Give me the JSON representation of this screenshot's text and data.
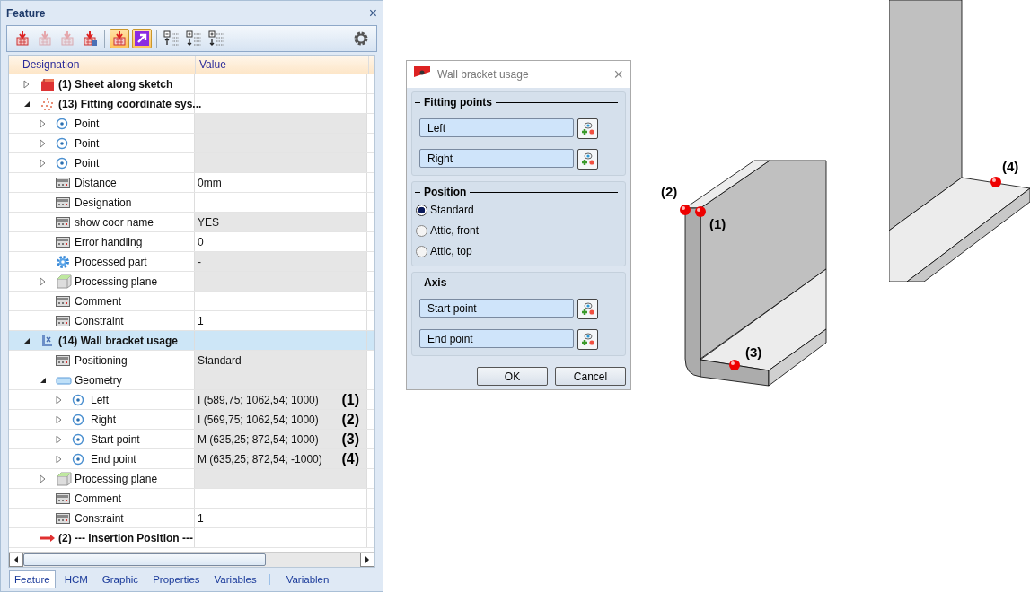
{
  "panel": {
    "title": "Feature",
    "close": "×"
  },
  "toolbar": [
    {
      "kind": "insert",
      "on": false,
      "disabled": false
    },
    {
      "kind": "insert",
      "on": false,
      "disabled": true
    },
    {
      "kind": "insert",
      "on": false,
      "disabled": true
    },
    {
      "kind": "insert-edit",
      "on": false,
      "disabled": false
    },
    {
      "kind": "separator"
    },
    {
      "kind": "insert",
      "on": true,
      "disabled": false
    },
    {
      "kind": "arrow",
      "on": true,
      "disabled": false
    },
    {
      "kind": "separator"
    },
    {
      "kind": "collapse",
      "on": false,
      "disabled": false
    },
    {
      "kind": "expand-level",
      "on": false,
      "disabled": false
    },
    {
      "kind": "expand",
      "on": false,
      "disabled": false
    },
    {
      "kind": "settings",
      "on": false,
      "disabled": false
    }
  ],
  "table": {
    "columns": [
      "Designation",
      "Value"
    ],
    "rows": [
      {
        "label": "(1) Sheet along sketch",
        "kind": "sheet",
        "expanded": false,
        "selected": false,
        "read_only": false
      },
      {
        "label": "(13) Fitting coordinate sys...",
        "kind": "coordinates",
        "expanded": true,
        "selected": false,
        "read_only": false,
        "children": [
          {
            "label": "Point",
            "kind": "point",
            "expanded": false,
            "selected": false,
            "read_only": true
          },
          {
            "label": "Point",
            "kind": "point",
            "expanded": false,
            "selected": false,
            "read_only": true
          },
          {
            "label": "Point",
            "kind": "point",
            "expanded": false,
            "selected": false,
            "read_only": true
          },
          {
            "label": "Distance",
            "value": "0mm",
            "kind": "parameter",
            "selected": false,
            "read_only": false
          },
          {
            "label": "Designation",
            "kind": "parameter",
            "selected": false,
            "read_only": false
          },
          {
            "label": "show coor name",
            "value": "YES",
            "kind": "parameter",
            "selected": false,
            "read_only": true
          },
          {
            "label": "Error handling",
            "value": "0",
            "kind": "parameter",
            "selected": false,
            "read_only": false
          },
          {
            "label": "Processed part",
            "value": "-",
            "kind": "gear",
            "selected": false,
            "read_only": true
          },
          {
            "label": "Processing plane",
            "kind": "plane",
            "expanded": false,
            "selected": false,
            "read_only": true
          },
          {
            "label": "Comment",
            "kind": "parameter",
            "selected": false,
            "read_only": false
          },
          {
            "label": "Constraint",
            "value": "1",
            "kind": "parameter",
            "selected": false,
            "read_only": false
          }
        ]
      },
      {
        "label": "(14) Wall bracket usage",
        "kind": "bracket",
        "expanded": true,
        "selected": true,
        "read_only": false,
        "children": [
          {
            "label": "Positioning",
            "value": "Standard",
            "kind": "parameter",
            "selected": false,
            "read_only": true
          },
          {
            "label": "Geometry",
            "kind": "geometry",
            "expanded": true,
            "selected": false,
            "read_only": true,
            "children": [
              {
                "label": "Left",
                "value": "I  (589,75; 1062,54; 1000)",
                "annotation": "(1)",
                "kind": "point",
                "expanded": false,
                "selected": false,
                "read_only": true
              },
              {
                "label": "Right",
                "value": "I  (569,75; 1062,54; 1000)",
                "annotation": "(2)",
                "kind": "point",
                "expanded": false,
                "selected": false,
                "read_only": true
              },
              {
                "label": "Start point",
                "value": "M  (635,25; 872,54; 1000)",
                "annotation": "(3)",
                "kind": "point",
                "expanded": false,
                "selected": false,
                "read_only": true
              },
              {
                "label": "End point",
                "value": "M  (635,25; 872,54; -1000)",
                "annotation": "(4)",
                "kind": "point",
                "expanded": false,
                "selected": false,
                "read_only": true
              }
            ]
          },
          {
            "label": "Processing plane",
            "kind": "plane",
            "expanded": false,
            "selected": false,
            "read_only": true
          },
          {
            "label": "Comment",
            "kind": "parameter",
            "selected": false,
            "read_only": false
          },
          {
            "label": "Constraint",
            "value": "1",
            "kind": "parameter",
            "selected": false,
            "read_only": false
          }
        ]
      },
      {
        "label": "(2) --- Insertion Position ---",
        "kind": "arrow",
        "selected": false,
        "read_only": false
      }
    ]
  },
  "tabs": [
    {
      "label": "Feature",
      "selected": true
    },
    {
      "label": "HCM",
      "selected": false
    },
    {
      "label": "Graphic",
      "selected": false
    },
    {
      "label": "Properties",
      "selected": false
    },
    {
      "label": "Variables",
      "selected": false
    },
    {
      "label": "Variablen",
      "selected": false
    }
  ],
  "dialog": {
    "title": "Wall bracket usage",
    "close": "×",
    "groups": [
      {
        "title": "Fitting points",
        "kind": "fields",
        "fields": [
          "Left",
          "Right"
        ]
      },
      {
        "title": "Position",
        "kind": "radios",
        "options": [
          {
            "label": "Standard",
            "selected": true
          },
          {
            "label": "Attic, front",
            "selected": false
          },
          {
            "label": "Attic, top",
            "selected": false
          }
        ]
      },
      {
        "title": "Axis",
        "kind": "fields",
        "fields": [
          "Start point",
          "End point"
        ]
      }
    ],
    "buttons": [
      "OK",
      "Cancel"
    ]
  },
  "viewport": {
    "labels_front": [
      "(2)",
      "(1)",
      "(3)"
    ],
    "labels_back": [
      "(4)"
    ]
  }
}
